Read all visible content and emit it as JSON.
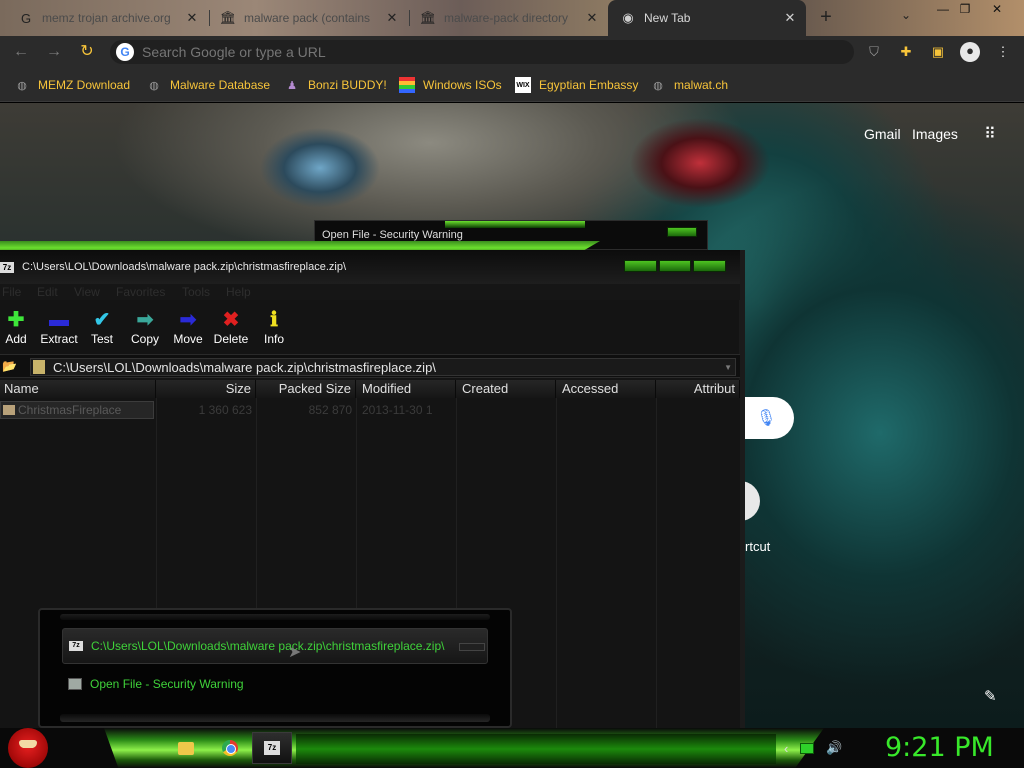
{
  "browser": {
    "tabs": [
      {
        "title": "memz trojan archive.org",
        "icon": "google-g-icon",
        "active": false
      },
      {
        "title": "malware pack (contains",
        "icon": "archive-icon",
        "active": false
      },
      {
        "title": "malware-pack directory",
        "icon": "archive-icon",
        "active": false
      },
      {
        "title": "New Tab",
        "icon": "chrome-icon",
        "active": true
      }
    ],
    "omnibox_placeholder": "Search Google or type a URL",
    "bookmarks": [
      {
        "label": "MEMZ Download",
        "icon": "globe-icon"
      },
      {
        "label": "Malware Database",
        "icon": "globe-icon"
      },
      {
        "label": "Bonzi BUDDY!",
        "icon": "bonzi-icon"
      },
      {
        "label": "Windows ISOs",
        "icon": "windows-icon"
      },
      {
        "label": "Egyptian Embassy",
        "icon": "wix-icon"
      },
      {
        "label": "malwat.ch",
        "icon": "globe-icon"
      }
    ],
    "ntp": {
      "gmail": "Gmail",
      "images": "Images",
      "shortcut_label": "rtcut"
    },
    "accent": "#f7c43a"
  },
  "security_warning": {
    "title": "Open File - Security Warning"
  },
  "sevenzip": {
    "window_title": "C:\\Users\\LOL\\Downloads\\malware pack.zip\\christmasfireplace.zip\\",
    "menu": [
      "File",
      "Edit",
      "View",
      "Favorites",
      "Tools",
      "Help"
    ],
    "toolbar": [
      {
        "label": "Add",
        "icon": "plus-icon"
      },
      {
        "label": "Extract",
        "icon": "minus-icon"
      },
      {
        "label": "Test",
        "icon": "check-icon"
      },
      {
        "label": "Copy",
        "icon": "copy-arrow-icon"
      },
      {
        "label": "Move",
        "icon": "move-arrow-icon"
      },
      {
        "label": "Delete",
        "icon": "x-icon"
      },
      {
        "label": "Info",
        "icon": "info-icon"
      }
    ],
    "address": "C:\\Users\\LOL\\Downloads\\malware pack.zip\\christmasfireplace.zip\\",
    "columns": [
      "Name",
      "Size",
      "Packed Size",
      "Modified",
      "Created",
      "Accessed",
      "Attribut"
    ],
    "rows": [
      {
        "name": "ChristmasFireplace",
        "size": "1 360 623",
        "packed": "852 870",
        "modified": "2013-11-30 1"
      }
    ]
  },
  "taskbar_preview": {
    "item1": "C:\\Users\\LOL\\Downloads\\malware pack.zip\\christmasfireplace.zip\\",
    "item2": "Open File - Security Warning"
  },
  "taskbar": {
    "clock": "9:21 PM",
    "accent": "#38e82a"
  }
}
